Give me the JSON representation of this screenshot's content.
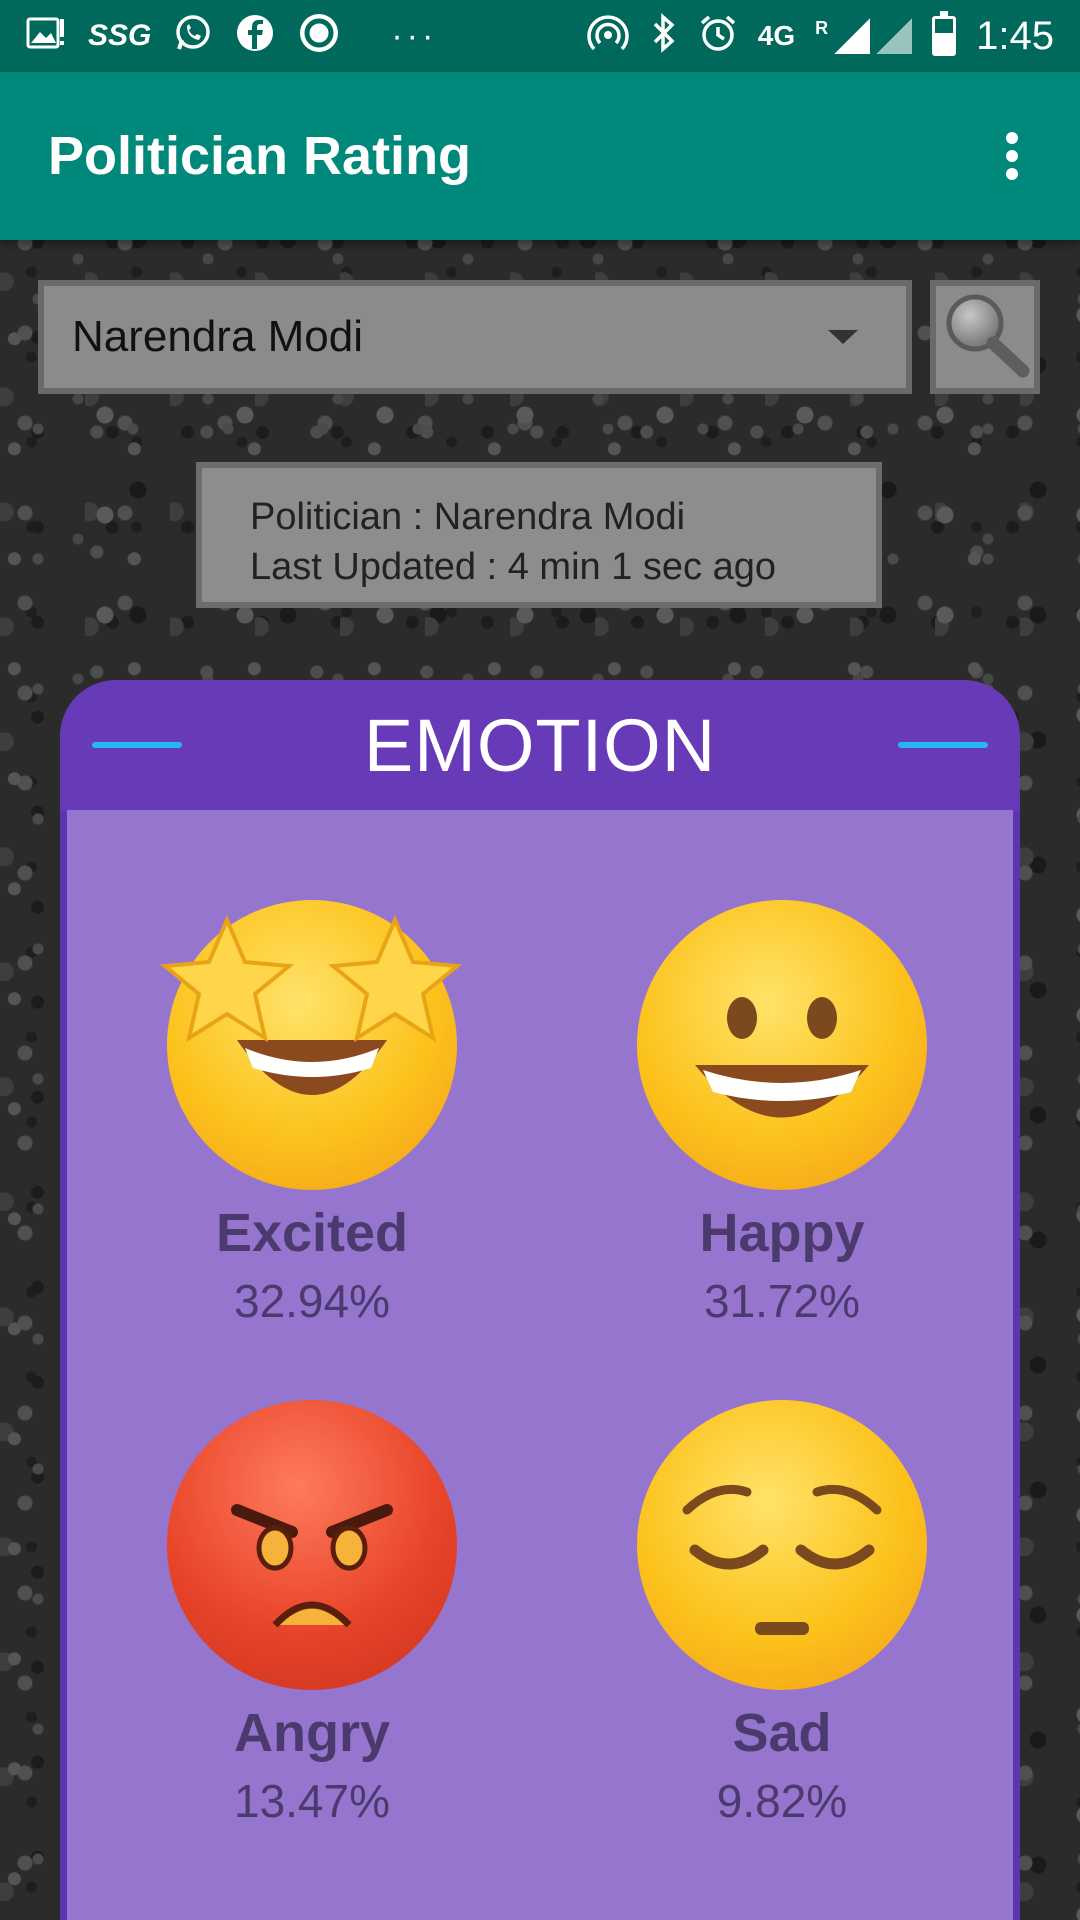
{
  "status_bar": {
    "carrier_label": "SSG",
    "network": "4G",
    "roaming": "R",
    "time": "1:45",
    "overflow_dots": "···"
  },
  "app_bar": {
    "title": "Politician Rating"
  },
  "selector": {
    "selected": "Narendra Modi"
  },
  "info": {
    "politician_line": "Politician : Narendra Modi",
    "updated_line": "Last Updated : 4 min 1 sec ago"
  },
  "emotion_card": {
    "title": "EMOTION",
    "accent_color": "#673ab7",
    "items": [
      {
        "label": "Excited",
        "percent": "32.94%",
        "icon": "star-struck-face-icon"
      },
      {
        "label": "Happy",
        "percent": "31.72%",
        "icon": "grinning-face-icon"
      },
      {
        "label": "Angry",
        "percent": "13.47%",
        "icon": "angry-face-icon"
      },
      {
        "label": "Sad",
        "percent": "9.82%",
        "icon": "pensive-face-icon"
      }
    ]
  },
  "colors": {
    "status_bar": "#00695c",
    "app_bar": "#00897b",
    "card_header": "#673ab7",
    "card_body": "#9575cd"
  }
}
